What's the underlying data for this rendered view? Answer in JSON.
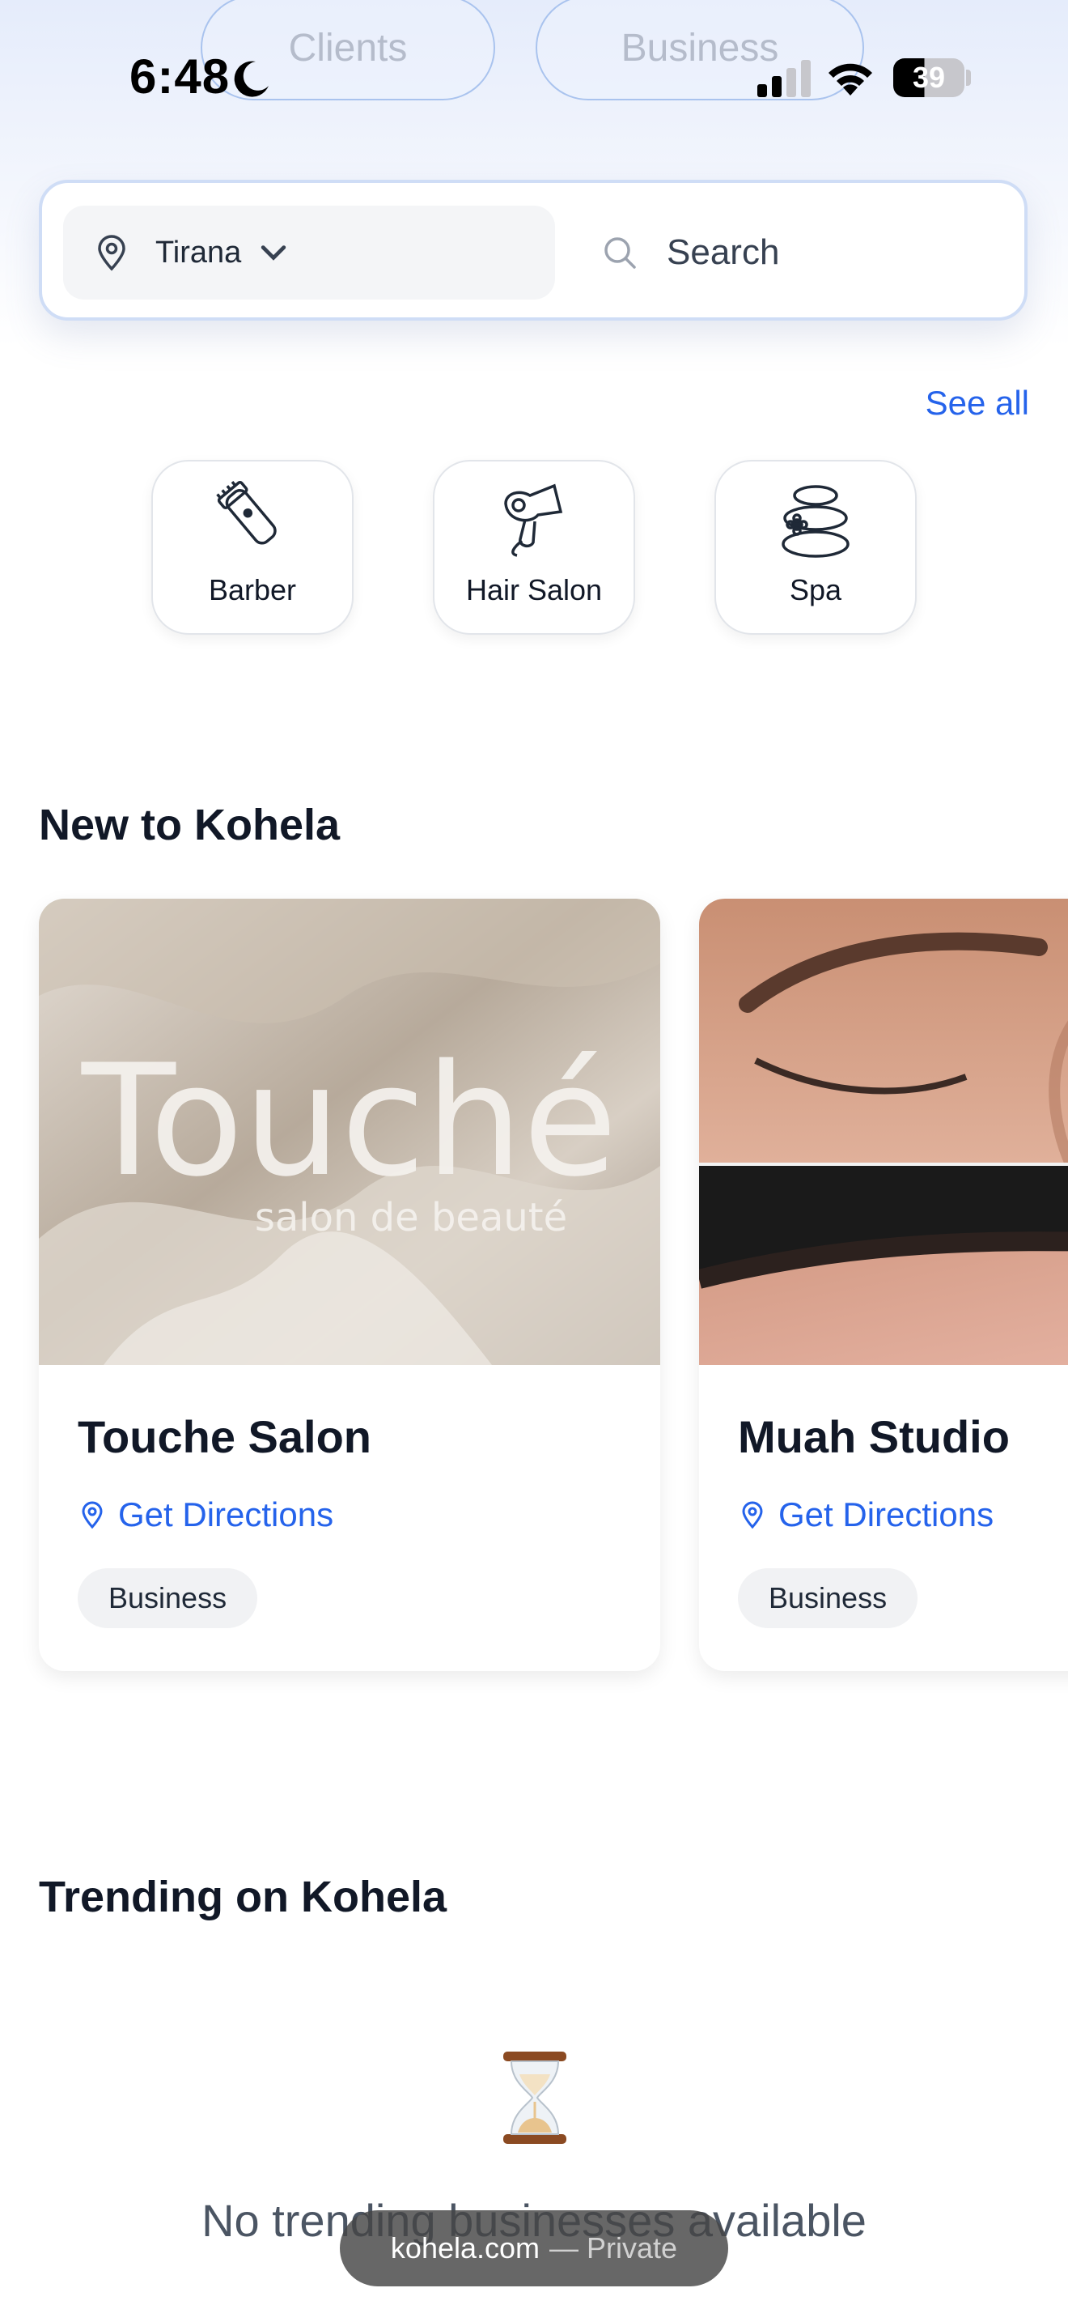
{
  "top_tabs": [
    "Clients",
    "Business"
  ],
  "status_bar": {
    "time": "6:48",
    "battery": "39"
  },
  "search_bar": {
    "location": "Tirana",
    "placeholder": "Search"
  },
  "see_all": "See all",
  "categories": [
    {
      "label": "Barber",
      "icon": "clipper-icon"
    },
    {
      "label": "Hair Salon",
      "icon": "hair-dryer-icon"
    },
    {
      "label": "Spa",
      "icon": "spa-stones-icon"
    }
  ],
  "new_section": {
    "title": "New to Kohela",
    "businesses": [
      {
        "name": "Touche Salon",
        "directions": "Get Directions",
        "tag": "Business",
        "image_logo_text": "Touché",
        "image_logo_sub": "salon de beauté"
      },
      {
        "name": "Muah Studio",
        "directions": "Get Directions",
        "tag": "Business"
      }
    ]
  },
  "trending_section": {
    "title": "Trending on Kohela",
    "empty_text": "No trending businesses available"
  },
  "browser": {
    "url": "kohela.com",
    "mode": "— Private"
  },
  "colors": {
    "accent": "#2563eb",
    "text": "#111827",
    "border": "#cfddf6"
  }
}
